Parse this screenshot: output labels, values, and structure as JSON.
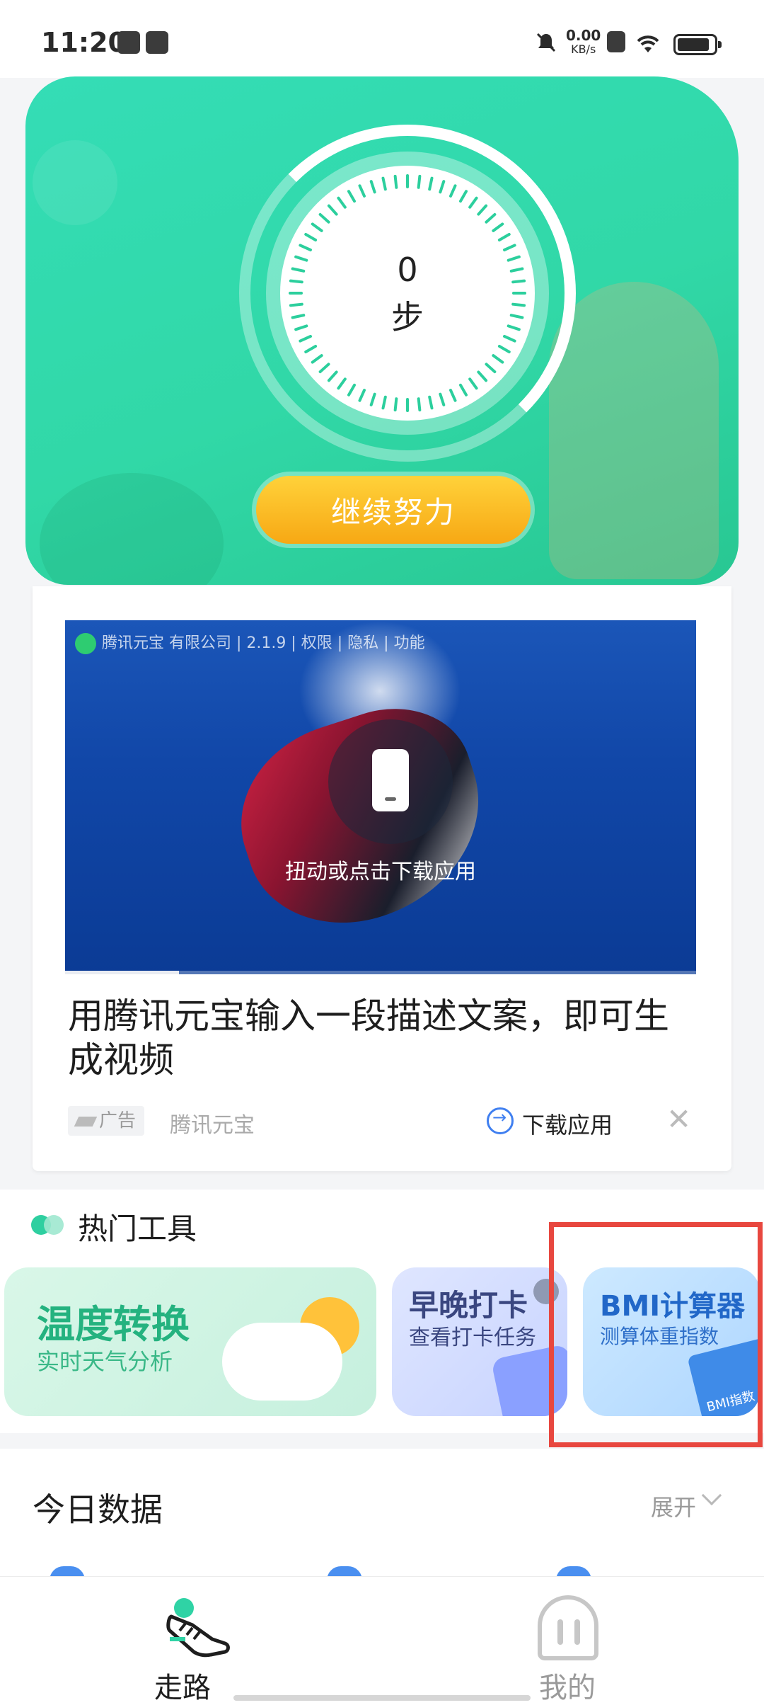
{
  "status_bar": {
    "time": "11:20",
    "net_speed_value": "0.00",
    "net_speed_unit": "KB/s",
    "icons": [
      "message-icon",
      "calendar-icon",
      "mute-icon",
      "sim-icon",
      "wifi-icon",
      "battery-icon"
    ]
  },
  "hero": {
    "step_count": "0",
    "step_unit": "步",
    "cta_label": "继续努力"
  },
  "ad": {
    "video_meta": "腾讯元宝 有限公司 | 2.1.9 | 权限 | 隐私 | 功能",
    "video_hint": "扭动或点击下载应用",
    "headline": "用腾讯元宝输入一段描述文案，即可生成视频",
    "tag": "广告",
    "source": "腾讯元宝",
    "download_label": "下载应用",
    "close_glyph": "✕",
    "progress_fraction": 0.18
  },
  "hot_tools": {
    "title": "热门工具",
    "items": [
      {
        "name": "温度转换",
        "subtitle": "实时天气分析"
      },
      {
        "name": "早晚打卡",
        "subtitle": "查看打卡任务"
      },
      {
        "name": "BMI计算器",
        "subtitle": "测算体重指数",
        "badge": "BMI指数"
      }
    ]
  },
  "today": {
    "title": "今日数据",
    "expand_label": "展开"
  },
  "bottom_nav": {
    "items": [
      {
        "label": "走路",
        "icon": "shoe-icon",
        "active": true
      },
      {
        "label": "我的",
        "icon": "ghost-icon",
        "active": false
      }
    ]
  },
  "colors": {
    "hero_green": "#31d8a7",
    "cta_orange": "#f7a814",
    "highlight_red": "#e8473f",
    "download_blue": "#3f7ff0"
  }
}
